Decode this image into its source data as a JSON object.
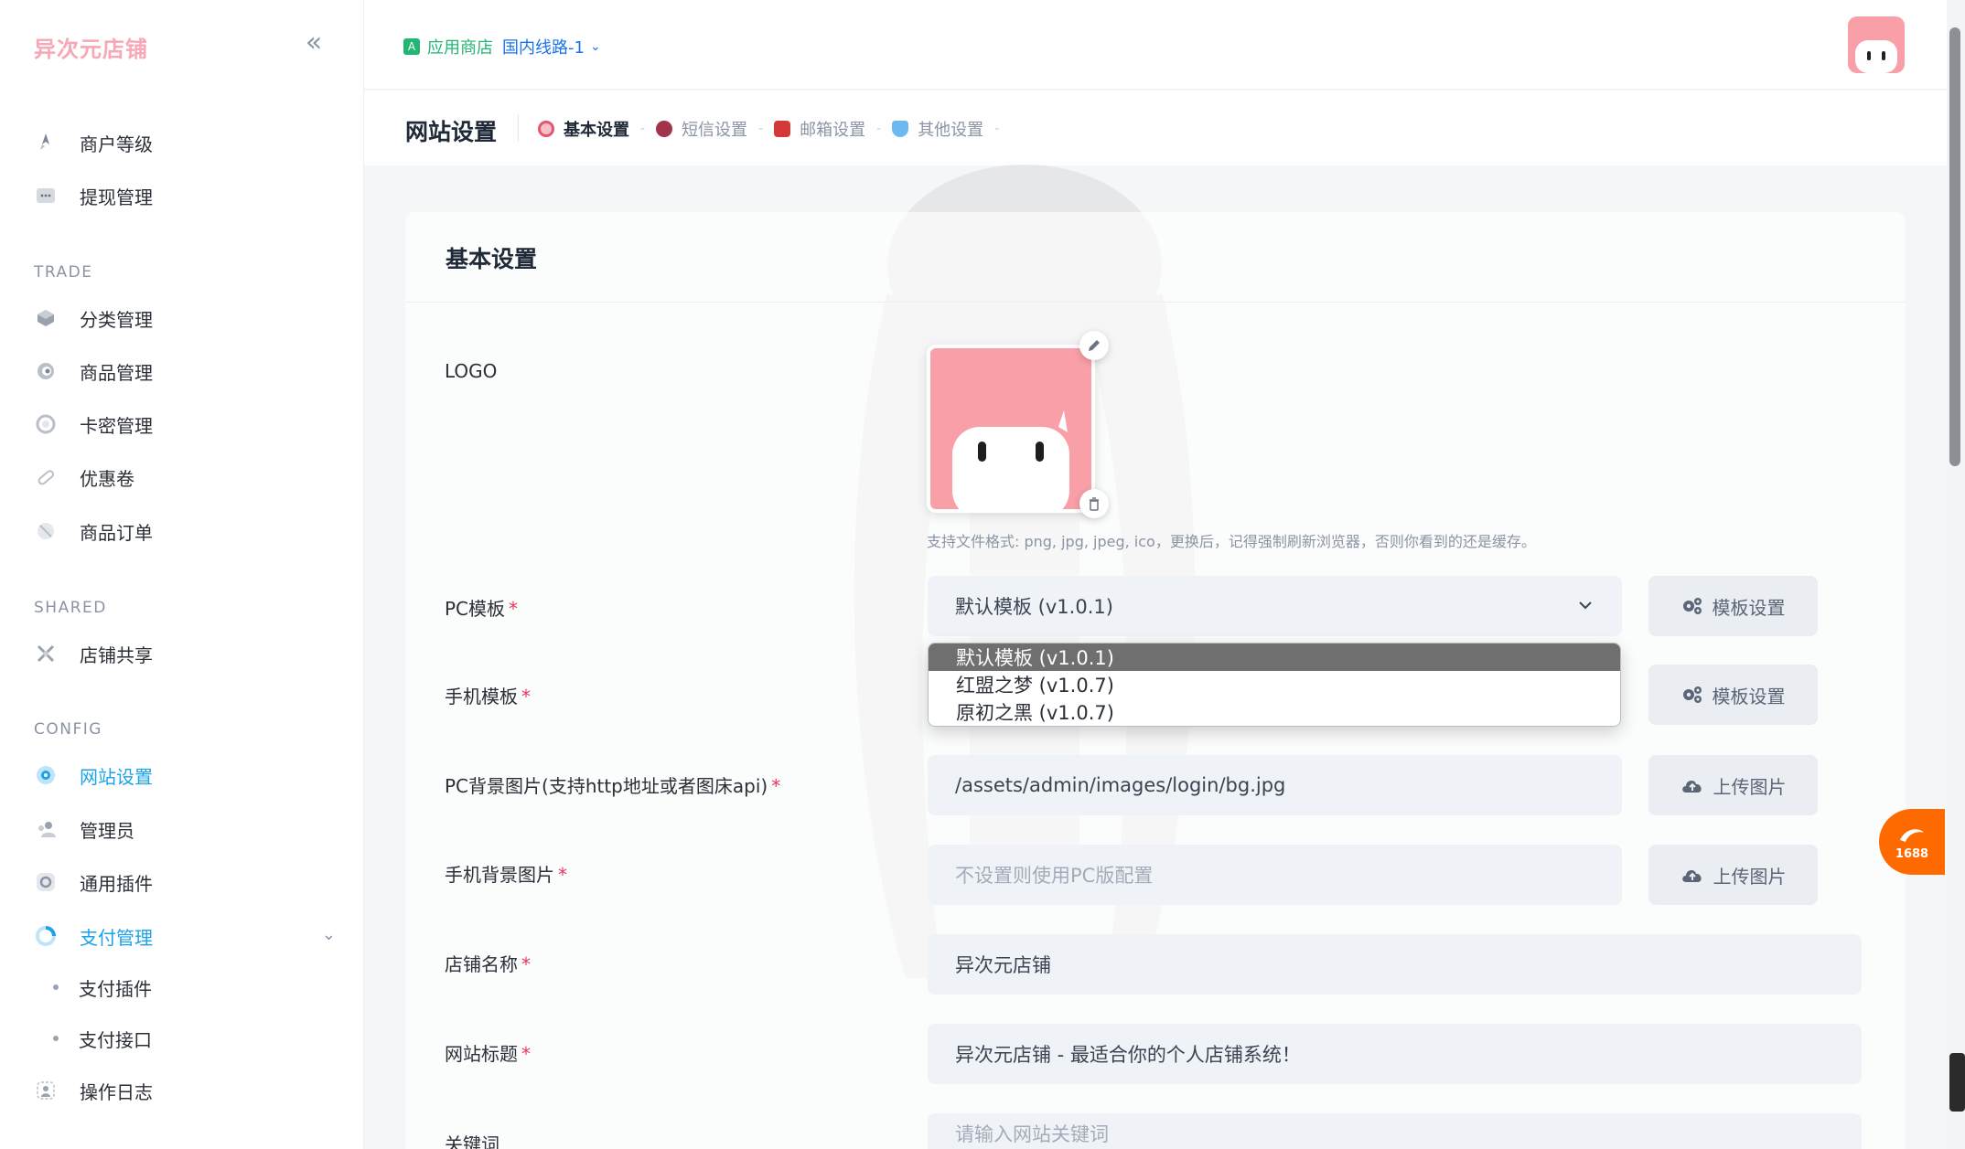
{
  "brand": "异次元店铺",
  "sidebar": {
    "items_top": [
      {
        "label": "商户等级",
        "icon": "rocket-icon"
      },
      {
        "label": "提现管理",
        "icon": "wallet-icon"
      }
    ],
    "trade_label": "TRADE",
    "trade_items": [
      {
        "label": "分类管理",
        "icon": "category-icon"
      },
      {
        "label": "商品管理",
        "icon": "product-icon"
      },
      {
        "label": "卡密管理",
        "icon": "key-icon"
      },
      {
        "label": "优惠卷",
        "icon": "coupon-icon"
      },
      {
        "label": "商品订单",
        "icon": "order-icon"
      }
    ],
    "shared_label": "SHARED",
    "shared_items": [
      {
        "label": "店铺共享",
        "icon": "share-icon"
      }
    ],
    "config_label": "CONFIG",
    "config_items": [
      {
        "label": "网站设置",
        "icon": "settings-icon",
        "active": true
      },
      {
        "label": "管理员",
        "icon": "admin-icon"
      },
      {
        "label": "通用插件",
        "icon": "plugin-icon"
      },
      {
        "label": "支付管理",
        "icon": "payment-icon",
        "active": true
      }
    ],
    "payment_sub": [
      "支付插件",
      "支付接口"
    ],
    "log_item": {
      "label": "操作日志",
      "icon": "log-icon"
    }
  },
  "topbar": {
    "store": "应用商店",
    "route": "国内线路-1"
  },
  "page": {
    "title": "网站设置",
    "tabs": [
      {
        "label": "基本设置",
        "active": true
      },
      {
        "label": "短信设置",
        "active": false
      },
      {
        "label": "邮箱设置",
        "active": false
      },
      {
        "label": "其他设置",
        "active": false
      }
    ]
  },
  "card": {
    "title": "基本设置"
  },
  "form": {
    "logo_label": "LOGO",
    "logo_hint": "支持文件格式: png, jpg, jpeg, ico，更换后，记得强制刷新浏览器，否则你看到的还是缓存。",
    "pc_template_label": "PC模板",
    "pc_template_value": "默认模板 (v1.0.1)",
    "template_settings_btn": "模板设置",
    "mobile_template_label": "手机模板",
    "template_options": [
      "默认模板 (v1.0.1)",
      "红盟之梦 (v1.0.7)",
      "原初之黑 (v1.0.7)"
    ],
    "pc_bg_label": "PC背景图片(支持http地址或者图床api)",
    "pc_bg_value": "/assets/admin/images/login/bg.jpg",
    "upload_btn": "上传图片",
    "mobile_bg_label": "手机背景图片",
    "mobile_bg_placeholder": "不设置则使用PC版配置",
    "shop_name_label": "店铺名称",
    "shop_name_value": "异次元店铺",
    "site_title_label": "网站标题",
    "site_title_value": "异次元店铺 - 最适合你的个人店铺系统！",
    "keywords_label": "关键词",
    "keywords_placeholder": "请输入网站关键词",
    "required_mark": "*"
  },
  "float_badge": "1688",
  "colors": {
    "accent": "#1aa3ea",
    "brand": "#f7a7b6",
    "required": "#e8365f",
    "avatar": "#f89fa8"
  }
}
